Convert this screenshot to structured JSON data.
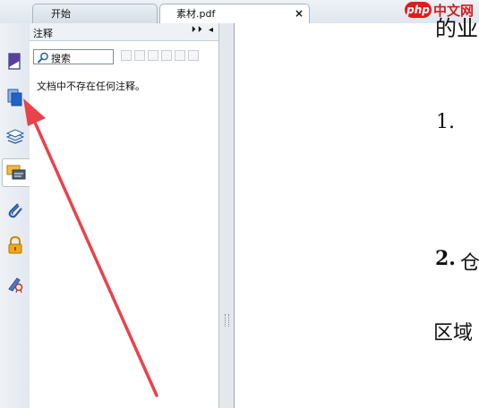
{
  "tabs": [
    {
      "label": "开始",
      "active": false
    },
    {
      "label": "素材.pdf",
      "active": true,
      "close": "×"
    }
  ],
  "watermark": {
    "badge": "php",
    "text": "中文网"
  },
  "toolbar": {
    "icons": [
      "page-thumbnail-icon",
      "pages-icon",
      "layers-icon",
      "comments-icon",
      "attachments-icon",
      "security-icon",
      "signatures-icon"
    ],
    "active_index": 3
  },
  "comments_panel": {
    "title": "注释",
    "controls": "⏵⏵ ◂",
    "search_placeholder": "搜索",
    "empty_message": "文档中不存在任何注释。"
  },
  "document": {
    "top_fragment": "的业",
    "item1": "1.",
    "item2_number": "2.",
    "item2_char": "仓",
    "area_text": "区域"
  },
  "colors": {
    "arrow": "#e8434a",
    "accent_blue": "#2266cc",
    "lock": "#f2a718",
    "watermark_red": "#e31b1b"
  }
}
